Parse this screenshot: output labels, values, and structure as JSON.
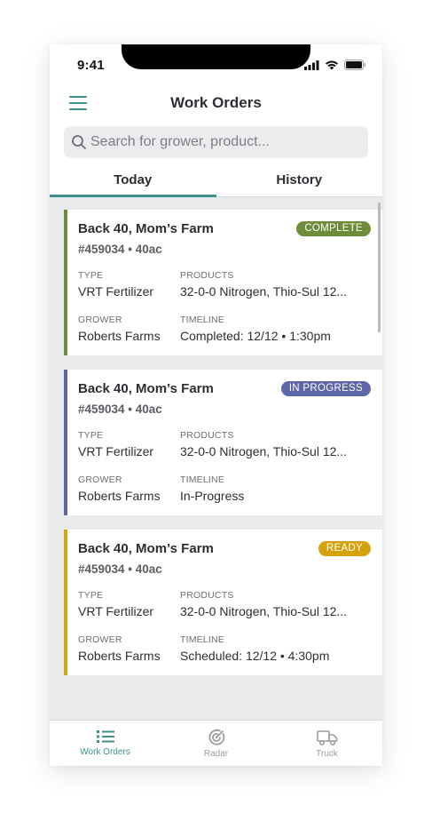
{
  "status_bar": {
    "time": "9:41"
  },
  "header": {
    "title": "Work Orders",
    "menu_icon": "hamburger-menu-icon"
  },
  "search": {
    "placeholder": "Search for grower, product..."
  },
  "tabs": [
    {
      "label": "Today",
      "active": true
    },
    {
      "label": "History",
      "active": false
    }
  ],
  "labels": {
    "type": "TYPE",
    "products": "PRODUCTS",
    "grower": "GROWER",
    "timeline": "TIMELINE"
  },
  "orders": [
    {
      "title": "Back 40, Mom’s Farm",
      "subtitle": "#459034 • 40ac",
      "status": "COMPLETE",
      "status_color": "#6e8c3a",
      "type": "VRT Fertilizer",
      "products": "32-0-0 Nitrogen, Thio-Sul 12...",
      "grower": "Roberts Farms",
      "timeline": "Completed: 12/12 • 1:30pm"
    },
    {
      "title": "Back 40, Mom’s Farm",
      "subtitle": "#459034 • 40ac",
      "status": "IN PROGRESS",
      "status_color": "#5d66a8",
      "type": "VRT Fertilizer",
      "products": "32-0-0 Nitrogen, Thio-Sul 12...",
      "grower": "Roberts Farms",
      "timeline": "In-Progress"
    },
    {
      "title": "Back 40, Mom’s Farm",
      "subtitle": "#459034 • 40ac",
      "status": "READY",
      "status_color": "#d4a20a",
      "type": "VRT Fertilizer",
      "products": "32-0-0 Nitrogen, Thio-Sul 12...",
      "grower": "Roberts Farms",
      "timeline": "Scheduled: 12/12 • 4:30pm"
    }
  ],
  "bottom_nav": [
    {
      "label": "Work Orders",
      "icon": "list-icon",
      "active": true
    },
    {
      "label": "Radar",
      "icon": "radar-icon",
      "active": false
    },
    {
      "label": "Truck",
      "icon": "truck-icon",
      "active": false
    }
  ],
  "colors": {
    "accent": "#3f8f8a",
    "complete": "#6e8c3a",
    "in_progress": "#5d66a8",
    "ready": "#d4a20a"
  }
}
